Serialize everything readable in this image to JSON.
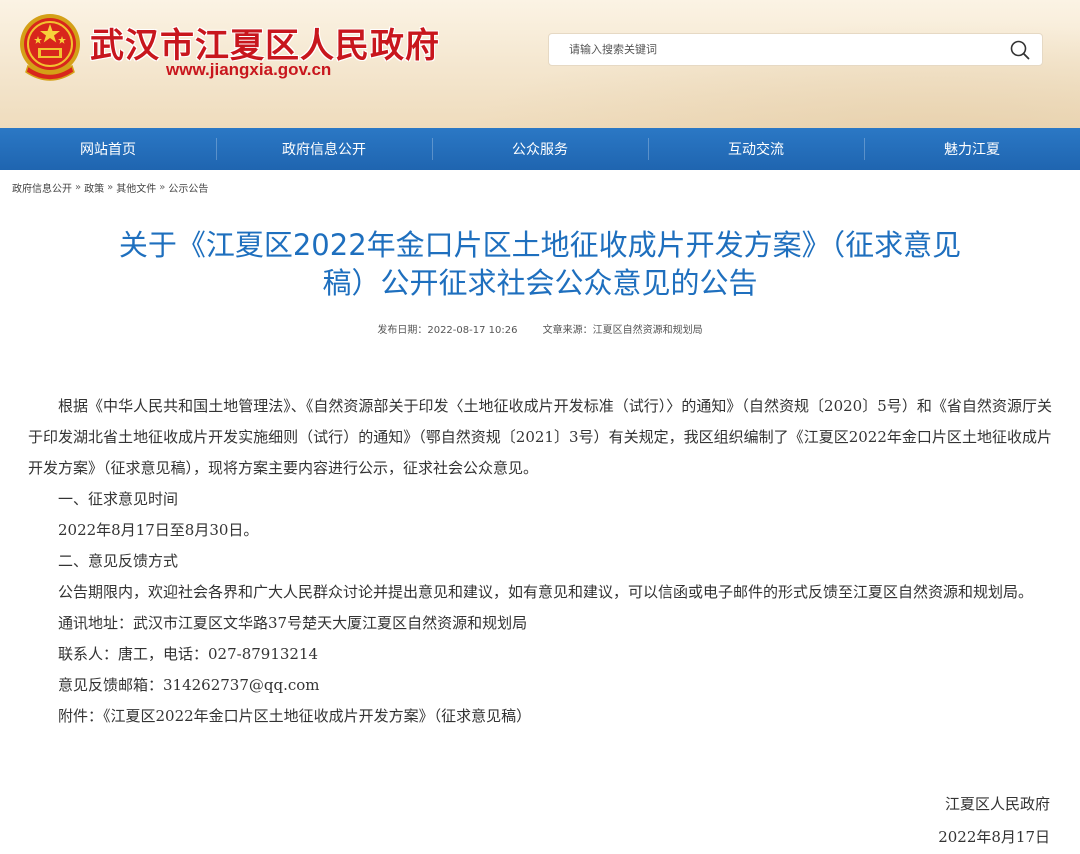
{
  "header": {
    "site_name": "武汉市江夏区人民政府",
    "site_url": "www.jiangxia.gov.cn",
    "search_placeholder": "请输入搜索关键词"
  },
  "nav": {
    "items": [
      {
        "label": "网站首页"
      },
      {
        "label": "政府信息公开"
      },
      {
        "label": "公众服务"
      },
      {
        "label": "互动交流"
      },
      {
        "label": "魅力江夏"
      }
    ]
  },
  "breadcrumb": {
    "items": [
      "政府信息公开",
      "政策",
      "其他文件",
      "公示公告"
    ],
    "separator": "»"
  },
  "article": {
    "title_line1": "关于《江夏区2022年金口片区土地征收成片开发方案》（征求意见",
    "title_line2": "稿）公开征求社会公众意见的公告",
    "publish_date": "发布日期：2022-08-17 10:26",
    "source": "文章来源：江夏区自然资源和规划局",
    "paragraphs": [
      "根据《中华人民共和国土地管理法》、《自然资源部关于印发〈土地征收成片开发标准（试行）〉的通知》（自然资规〔2020〕5号）和《省自然资源厅关于印发湖北省土地征收成片开发实施细则（试行）的通知》（鄂自然资规〔2021〕3号）有关规定，我区组织编制了《江夏区2022年金口片区土地征收成片开发方案》（征求意见稿），现将方案主要内容进行公示，征求社会公众意见。",
      "一、征求意见时间",
      "2022年8月17日至8月30日。",
      "二、意见反馈方式",
      "公告期限内，欢迎社会各界和广大人民群众讨论并提出意见和建议，如有意见和建议，可以信函或电子邮件的形式反馈至江夏区自然资源和规划局。",
      "通讯地址：武汉市江夏区文华路37号楚天大厦江夏区自然资源和规划局",
      "联系人：唐工，电话：027-87913214",
      "意见反馈邮箱：314262737@qq.com",
      "附件：《江夏区2022年金口片区土地征收成片开发方案》（征求意见稿）"
    ],
    "signature_org": "江夏区人民政府",
    "signature_date": "2022年8月17日"
  },
  "colors": {
    "nav_bg": "#2272bd",
    "title_blue": "#1e6fbe",
    "site_red": "#c8161d"
  },
  "icons": {
    "emblem": "national-emblem-icon",
    "search": "search-icon"
  }
}
